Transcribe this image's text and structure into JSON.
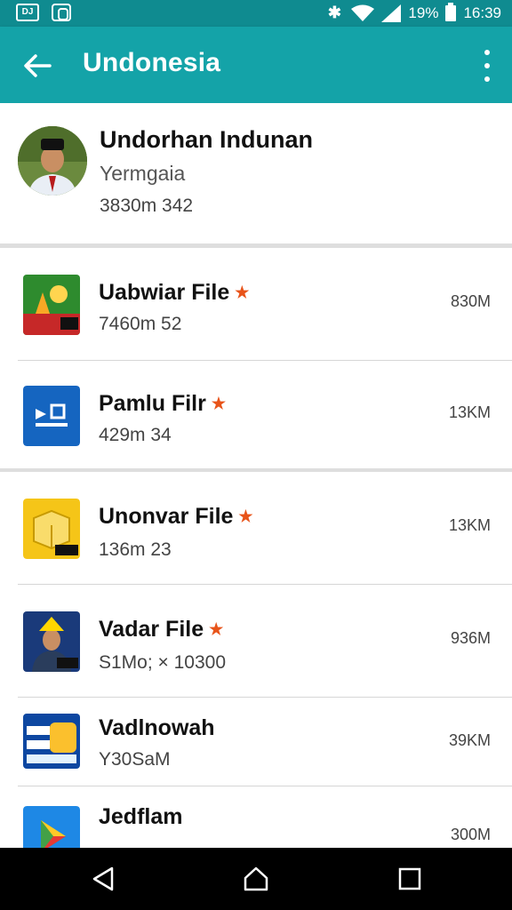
{
  "status_bar": {
    "battery": "19%",
    "time": "16:39"
  },
  "app_bar": {
    "title": "Undonesia"
  },
  "profile": {
    "name": "Undorhan Indunan",
    "subtitle": "Yermgaia",
    "meta": "3830m 342"
  },
  "files": [
    {
      "title": "Uabwiar File",
      "starred": true,
      "subtitle": "7460m 52",
      "size": "830M",
      "icon": "red-green-game-icon"
    },
    {
      "title": "Pamlu Filr",
      "starred": true,
      "subtitle": "429m 34",
      "size": "13KM",
      "icon": "blue-photo-icon"
    },
    {
      "title": "Unonvar File",
      "starred": true,
      "subtitle": "136m 23",
      "size": "13KM",
      "icon": "yellow-box-icon"
    },
    {
      "title": "Vadar File",
      "starred": true,
      "subtitle": "S1Mo; × 10300",
      "size": "936M",
      "icon": "portrait-yellow-hat-icon"
    },
    {
      "title": "Vadlnowah",
      "starred": false,
      "subtitle": "Y30SaM",
      "size": "39KM",
      "icon": "blue-text-logo-icon"
    },
    {
      "title": "Jedflam",
      "starred": false,
      "subtitle": "",
      "size": "300M",
      "icon": "play-store-icon"
    }
  ],
  "colors": {
    "status_bar": "#0f8b90",
    "app_bar": "#14a3a8",
    "star": "#e8541a"
  }
}
